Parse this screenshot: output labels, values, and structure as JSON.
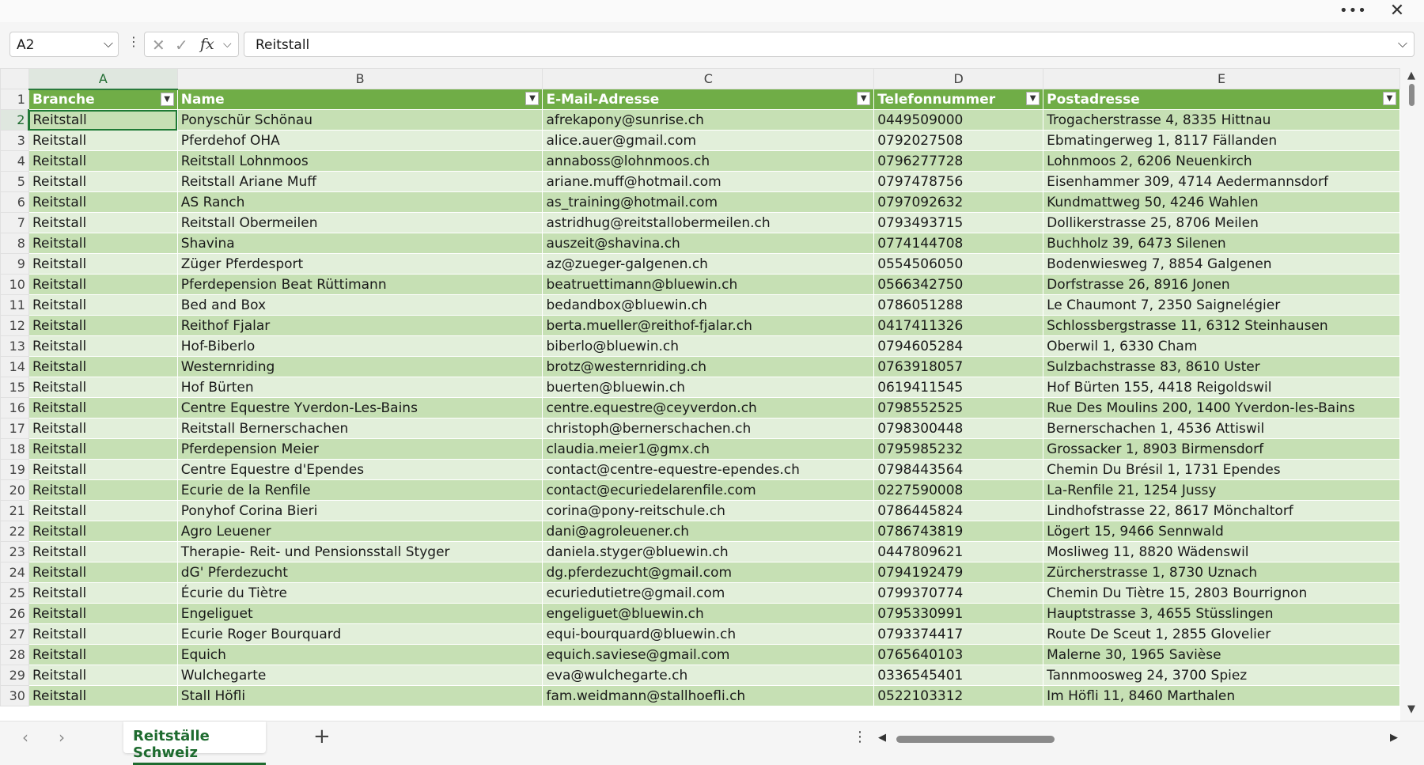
{
  "window": {
    "more_icon": "more-icon",
    "close_icon": "close-icon"
  },
  "formula_bar": {
    "name_box": "A2",
    "cancel_icon": "✕",
    "enter_icon": "✓",
    "fx_label": "fx",
    "formula": "Reitstall"
  },
  "columns": [
    "A",
    "B",
    "C",
    "D",
    "E"
  ],
  "headers": [
    "Branche",
    "Name",
    "E-Mail-Adresse",
    "Telefonnummer",
    "Postadresse"
  ],
  "rows": [
    [
      "Reitstall",
      "Ponyschür Schönau",
      "afrekapony@sunrise.ch",
      "0449509000",
      "Trogacherstrasse 4, 8335 Hittnau"
    ],
    [
      "Reitstall",
      "Pferdehof OHA",
      "alice.auer@gmail.com",
      "0792027508",
      "Ebmatingerweg 1, 8117 Fällanden"
    ],
    [
      "Reitstall",
      "Reitstall Lohnmoos",
      "annaboss@lohnmoos.ch",
      "0796277728",
      "Lohnmoos 2, 6206 Neuenkirch"
    ],
    [
      "Reitstall",
      "Reitstall Ariane Muff",
      "ariane.muff@hotmail.com",
      "0797478756",
      "Eisenhammer 309, 4714 Aedermannsdorf"
    ],
    [
      "Reitstall",
      "AS Ranch",
      "as_training@hotmail.com",
      "0797092632",
      "Kundmattweg 50, 4246 Wahlen"
    ],
    [
      "Reitstall",
      "Reitstall Obermeilen",
      "astridhug@reitstallobermeilen.ch",
      "0793493715",
      "Dollikerstrasse 25, 8706 Meilen"
    ],
    [
      "Reitstall",
      "Shavina",
      "auszeit@shavina.ch",
      "0774144708",
      "Buchholz 39, 6473 Silenen"
    ],
    [
      "Reitstall",
      "Züger Pferdesport",
      "az@zueger-galgenen.ch",
      "0554506050",
      "Bodenwiesweg 7, 8854 Galgenen"
    ],
    [
      "Reitstall",
      "Pferdepension Beat Rüttimann",
      "beatruettimann@bluewin.ch",
      "0566342750",
      "Dorfstrasse 26, 8916 Jonen"
    ],
    [
      "Reitstall",
      "Bed and Box",
      "bedandbox@bluewin.ch",
      "0786051288",
      "Le Chaumont 7, 2350 Saignelégier"
    ],
    [
      "Reitstall",
      "Reithof Fjalar",
      "berta.mueller@reithof-fjalar.ch",
      "0417411326",
      "Schlossbergstrasse 11, 6312 Steinhausen"
    ],
    [
      "Reitstall",
      "Hof-Biberlo",
      "biberlo@bluewin.ch",
      "0794605284",
      "Oberwil 1, 6330 Cham"
    ],
    [
      "Reitstall",
      "Westernriding",
      "brotz@westernriding.ch",
      "0763918057",
      "Sulzbachstrasse 83, 8610 Uster"
    ],
    [
      "Reitstall",
      "Hof Bürten",
      "buerten@bluewin.ch",
      "0619411545",
      "Hof Bürten 155, 4418 Reigoldswil"
    ],
    [
      "Reitstall",
      "Centre Equestre Yverdon-Les-Bains",
      "centre.equestre@ceyverdon.ch",
      "0798552525",
      "Rue Des Moulins 200, 1400 Yverdon-les-Bains"
    ],
    [
      "Reitstall",
      "Reitstall Bernerschachen",
      "christoph@bernerschachen.ch",
      "0798300448",
      "Bernerschachen 1, 4536 Attiswil"
    ],
    [
      "Reitstall",
      "Pferdepension Meier",
      "claudia.meier1@gmx.ch",
      "0795985232",
      "Grossacker 1, 8903 Birmensdorf"
    ],
    [
      "Reitstall",
      "Centre Equestre d'Ependes",
      "contact@centre-equestre-ependes.ch",
      "0798443564",
      "Chemin Du Brésil 1, 1731 Ependes"
    ],
    [
      "Reitstall",
      "Ecurie de la Renfile",
      "contact@ecuriedelarenfile.com",
      "0227590008",
      "La-Renfile 21, 1254 Jussy"
    ],
    [
      "Reitstall",
      "Ponyhof Corina Bieri",
      "corina@pony-reitschule.ch",
      "0786445824",
      "Lindhofstrasse 22, 8617 Mönchaltorf"
    ],
    [
      "Reitstall",
      "Agro Leuener",
      "dani@agroleuener.ch",
      "0786743819",
      "Lögert 15, 9466 Sennwald"
    ],
    [
      "Reitstall",
      "Therapie- Reit- und Pensionsstall Styger",
      "daniela.styger@bluewin.ch",
      "0447809621",
      "Mosliweg 11, 8820 Wädenswil"
    ],
    [
      "Reitstall",
      "dG' Pferdezucht",
      "dg.pferdezucht@gmail.com",
      "0794192479",
      "Zürcherstrasse 1, 8730 Uznach"
    ],
    [
      "Reitstall",
      "Écurie du Tiètre",
      "ecuriedutietre@gmail.com",
      "0799370774",
      "Chemin Du Tiètre 15, 2803 Bourrignon"
    ],
    [
      "Reitstall",
      "Engeliguet",
      "engeliguet@bluewin.ch",
      "0795330991",
      "Hauptstrasse 3, 4655 Stüsslingen"
    ],
    [
      "Reitstall",
      "Ecurie Roger Bourquard",
      "equi-bourquard@bluewin.ch",
      "0793374417",
      "Route De Sceut 1, 2855 Glovelier"
    ],
    [
      "Reitstall",
      "Equich",
      "equich.saviese@gmail.com",
      "0765640103",
      "Malerne 30, 1965 Savièse"
    ],
    [
      "Reitstall",
      "Wulchegarte",
      "eva@wulchegarte.ch",
      "0336545401",
      "Tannmoosweg 24, 3700 Spiez"
    ],
    [
      "Reitstall",
      "Stall Höfli",
      "fam.weidmann@stallhoefli.ch",
      "0522103312",
      "Im Höfli 11, 8460 Marthalen"
    ]
  ],
  "sheets": [
    "Reitställe Schweiz"
  ],
  "add_sheet_label": "+",
  "accent_color": "#70ad47"
}
